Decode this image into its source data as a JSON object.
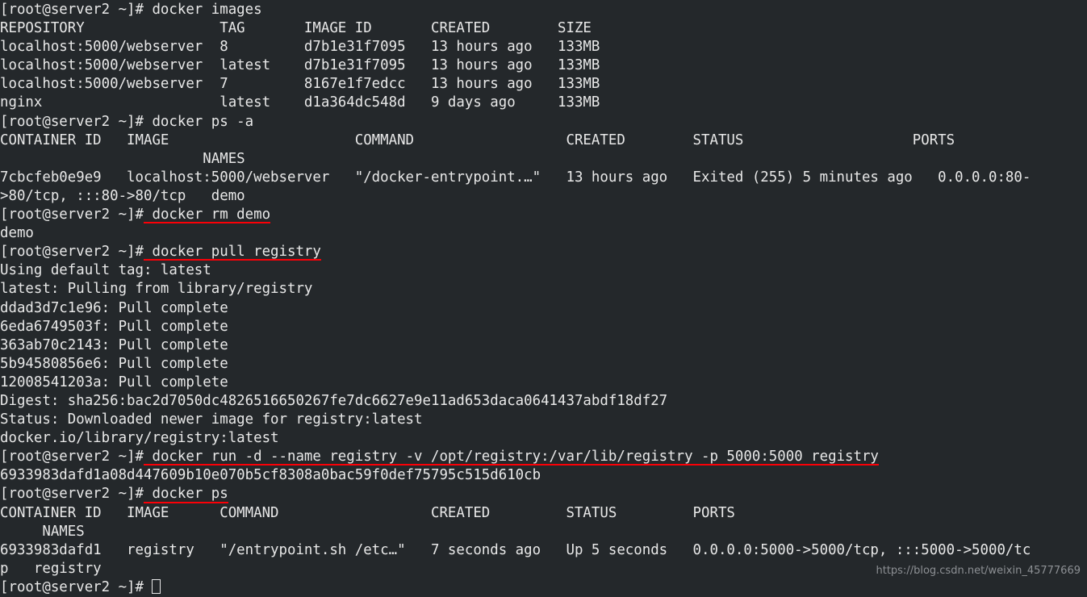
{
  "terminal": {
    "background_color": "#24282b",
    "foreground_color": "#e8e8e8",
    "underline_color": "#fb0007",
    "prompt": "[root@server2 ~]# ",
    "cursor": "block-outline-cursor"
  },
  "watermark": {
    "text": "https://blog.csdn.net/weixin_45777669",
    "color": "#8d9094"
  },
  "lines": [
    {
      "id": "l01",
      "segments": [
        {
          "t": "[root@server2 ~]# docker images"
        }
      ]
    },
    {
      "id": "l02",
      "segments": [
        {
          "t": "REPOSITORY                TAG       IMAGE ID       CREATED        SIZE"
        }
      ]
    },
    {
      "id": "l03",
      "segments": [
        {
          "t": "localhost:5000/webserver  8         d7b1e31f7095   13 hours ago   133MB"
        }
      ]
    },
    {
      "id": "l04",
      "segments": [
        {
          "t": "localhost:5000/webserver  latest    d7b1e31f7095   13 hours ago   133MB"
        }
      ]
    },
    {
      "id": "l05",
      "segments": [
        {
          "t": "localhost:5000/webserver  7         8167e1f7edcc   13 hours ago   133MB"
        }
      ]
    },
    {
      "id": "l06",
      "segments": [
        {
          "t": "nginx                     latest    d1a364dc548d   9 days ago     133MB"
        }
      ]
    },
    {
      "id": "l07",
      "segments": [
        {
          "t": "[root@server2 ~]# docker ps -a"
        }
      ]
    },
    {
      "id": "l08",
      "segments": [
        {
          "t": "CONTAINER ID   IMAGE                      COMMAND                  CREATED        STATUS                    PORTS"
        }
      ]
    },
    {
      "id": "l09",
      "segments": [
        {
          "t": "                        NAMES"
        }
      ]
    },
    {
      "id": "l10",
      "segments": [
        {
          "t": "7cbcfeb0e9e9   localhost:5000/webserver   \"/docker-entrypoint.…\"   13 hours ago   Exited (255) 5 minutes ago   0.0.0.0:80-"
        }
      ]
    },
    {
      "id": "l11",
      "segments": [
        {
          "t": ">80/tcp, :::80->80/tcp   demo"
        }
      ]
    },
    {
      "id": "l12",
      "segments": [
        {
          "t": "[root@server2 ~]#"
        },
        {
          "t": " docker rm demo",
          "u": true
        }
      ]
    },
    {
      "id": "l13",
      "segments": [
        {
          "t": "demo"
        }
      ]
    },
    {
      "id": "l14",
      "segments": [
        {
          "t": "[root@server2 ~]#"
        },
        {
          "t": " docker pull registry",
          "u": true
        }
      ]
    },
    {
      "id": "l15",
      "segments": [
        {
          "t": "Using default tag: latest"
        }
      ]
    },
    {
      "id": "l16",
      "segments": [
        {
          "t": "latest: Pulling from library/registry"
        }
      ]
    },
    {
      "id": "l17",
      "segments": [
        {
          "t": "ddad3d7c1e96: Pull complete"
        }
      ]
    },
    {
      "id": "l18",
      "segments": [
        {
          "t": "6eda6749503f: Pull complete"
        }
      ]
    },
    {
      "id": "l19",
      "segments": [
        {
          "t": "363ab70c2143: Pull complete"
        }
      ]
    },
    {
      "id": "l20",
      "segments": [
        {
          "t": "5b94580856e6: Pull complete"
        }
      ]
    },
    {
      "id": "l21",
      "segments": [
        {
          "t": "12008541203a: Pull complete"
        }
      ]
    },
    {
      "id": "l22",
      "segments": [
        {
          "t": "Digest: sha256:bac2d7050dc4826516650267fe7dc6627e9e11ad653daca0641437abdf18df27"
        }
      ]
    },
    {
      "id": "l23",
      "segments": [
        {
          "t": "Status: Downloaded newer image for registry:latest"
        }
      ]
    },
    {
      "id": "l24",
      "segments": [
        {
          "t": "docker.io/library/registry:latest"
        }
      ]
    },
    {
      "id": "l25",
      "segments": [
        {
          "t": "[root@server2 ~]#"
        },
        {
          "t": " docker run -d --name registry -v /opt/registry:/var/lib/registry -p 5000:5000 registry",
          "u": true
        }
      ]
    },
    {
      "id": "l26",
      "segments": [
        {
          "t": "6933983dafd1a08d447609b10e070b5cf8308a0bac59f0def75795c515d610cb"
        }
      ]
    },
    {
      "id": "l27",
      "segments": [
        {
          "t": "[root@server2 ~]#"
        },
        {
          "t": " docker ps",
          "u": true
        }
      ]
    },
    {
      "id": "l28",
      "segments": [
        {
          "t": "CONTAINER ID   IMAGE      COMMAND                  CREATED         STATUS         PORTS"
        }
      ]
    },
    {
      "id": "l29",
      "segments": [
        {
          "t": "     NAMES"
        }
      ]
    },
    {
      "id": "l30",
      "segments": [
        {
          "t": "6933983dafd1   registry   \"/entrypoint.sh /etc…\"   7 seconds ago   Up 5 seconds   0.0.0.0:5000->5000/tcp, :::5000->5000/tc"
        }
      ]
    },
    {
      "id": "l31",
      "segments": [
        {
          "t": "p   registry"
        }
      ]
    },
    {
      "id": "l32",
      "segments": [
        {
          "t": "[root@server2 ~]# "
        },
        {
          "cursor": true
        }
      ]
    }
  ]
}
